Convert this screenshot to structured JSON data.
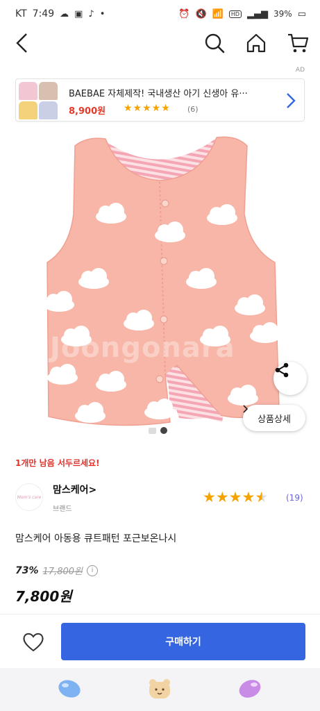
{
  "status_bar": {
    "carrier": "KT",
    "time": "7:49",
    "battery": "39%"
  },
  "ad": {
    "label": "AD",
    "title": "BAEBAE 자체제작! 국내생산 아기 신생아 유···",
    "price": "8,900원",
    "stars": "★★★★★",
    "review_count": "(6)"
  },
  "hero": {
    "watermark": "Joongonara",
    "detail_button": "상품상세",
    "current_slide": 2,
    "total_slides": 2
  },
  "product": {
    "stock_note": "1개만 남음 서두르세요!",
    "brand_name": "맘스케어>",
    "brand_type": "브랜드",
    "brand_logo_text": "Mom's care",
    "rating": 4.5,
    "rating_count": "(19)",
    "name": "맘스케어 아동용 큐트패턴 포근보온나시",
    "discount": "73%",
    "original_price": "17,800원",
    "sale_price": "7,800원"
  },
  "actions": {
    "buy_label": "구매하기"
  },
  "colors": {
    "primary": "#3565e0",
    "price_red": "#e03b2b",
    "star": "#f5a300",
    "count_purple": "#6b64d8",
    "vest_pink": "#f7b6a8"
  }
}
